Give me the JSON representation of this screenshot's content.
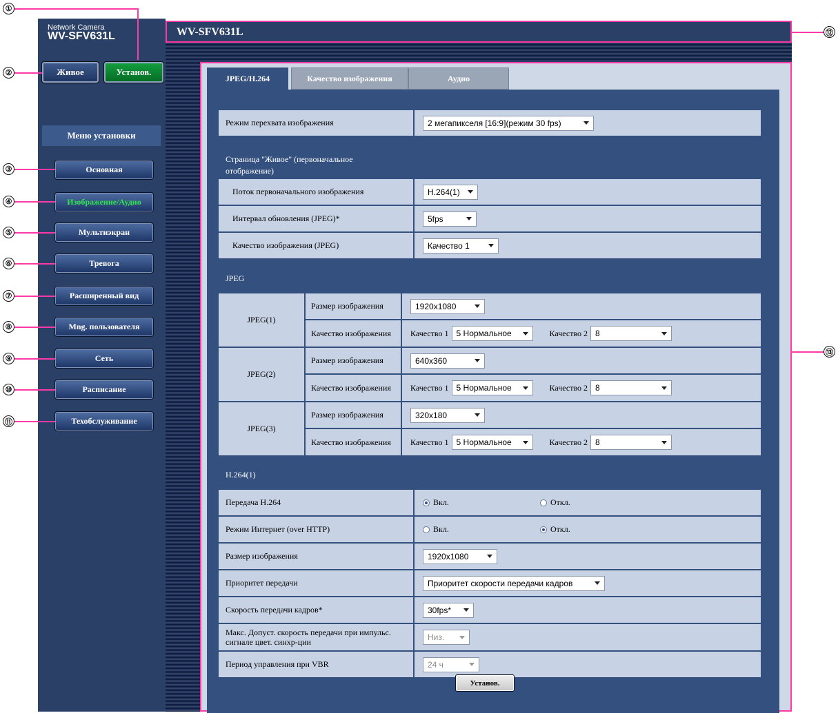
{
  "device": {
    "brand_small": "Network Camera",
    "model": "WV-SFV631L"
  },
  "header": {
    "title": "WV-SFV631L"
  },
  "top_buttons": {
    "live": "Живое",
    "setup": "Установ."
  },
  "menu": {
    "title": "Меню установки",
    "items": [
      "Основная",
      "Изображение/Аудио",
      "Мультиэкран",
      "Тревога",
      "Расширенный вид",
      "Mng. пользователя",
      "Сеть",
      "Расписание",
      "Техобслуживание"
    ]
  },
  "callouts": [
    "①",
    "②",
    "③",
    "④",
    "⑤",
    "⑥",
    "⑦",
    "⑧",
    "⑨",
    "⑩",
    "⑪",
    "⑫",
    "⑬"
  ],
  "tabs": [
    "JPEG/H.264",
    "Качество изображения",
    "Аудио"
  ],
  "capture_mode": {
    "label": "Режим перехвата изображения",
    "value": "2 мегапикселя [16:9](режим 30 fps)"
  },
  "live_page": {
    "heading": "Страница \"Живое\" (первоначальное отображение)",
    "stream_label": "Поток первоначального изображения",
    "stream_value": "H.264(1)",
    "refresh_label": "Интервал обновления (JPEG)*",
    "refresh_value": "5fps",
    "quality_label": "Качество изображения (JPEG)",
    "quality_value": "Качество 1"
  },
  "jpeg": {
    "heading": "JPEG",
    "size_label": "Размер изображения",
    "quality_label": "Качество изображения",
    "q1_label": "Качество 1",
    "q2_label": "Качество 2",
    "streams": [
      {
        "name": "JPEG(1)",
        "size": "1920x1080",
        "q1": "5 Нормальное",
        "q2": "8"
      },
      {
        "name": "JPEG(2)",
        "size": "640x360",
        "q1": "5 Нормальное",
        "q2": "8"
      },
      {
        "name": "JPEG(3)",
        "size": "320x180",
        "q1": "5 Нормальное",
        "q2": "8"
      }
    ]
  },
  "h264": {
    "heading": "H.264(1)",
    "on_label": "Вкл.",
    "off_label": "Откл.",
    "transmission_label": "Передача H.264",
    "internet_label": "Режим Интернет (over HTTP)",
    "size_label": "Размер изображения",
    "size_value": "1920x1080",
    "priority_label": "Приоритет передачи",
    "priority_value": "Приоритет скорости передачи кадров",
    "framerate_label": "Скорость передачи кадров*",
    "framerate_value": "30fps*",
    "max_rate_label": "Макс. Допуст. скорость передачи при импульс. сигнале цвет. синхр-ции",
    "max_rate_value": "Низ.",
    "vbr_label": "Период управления при VBR",
    "vbr_value": "24 ч"
  },
  "set_button": "Установ."
}
